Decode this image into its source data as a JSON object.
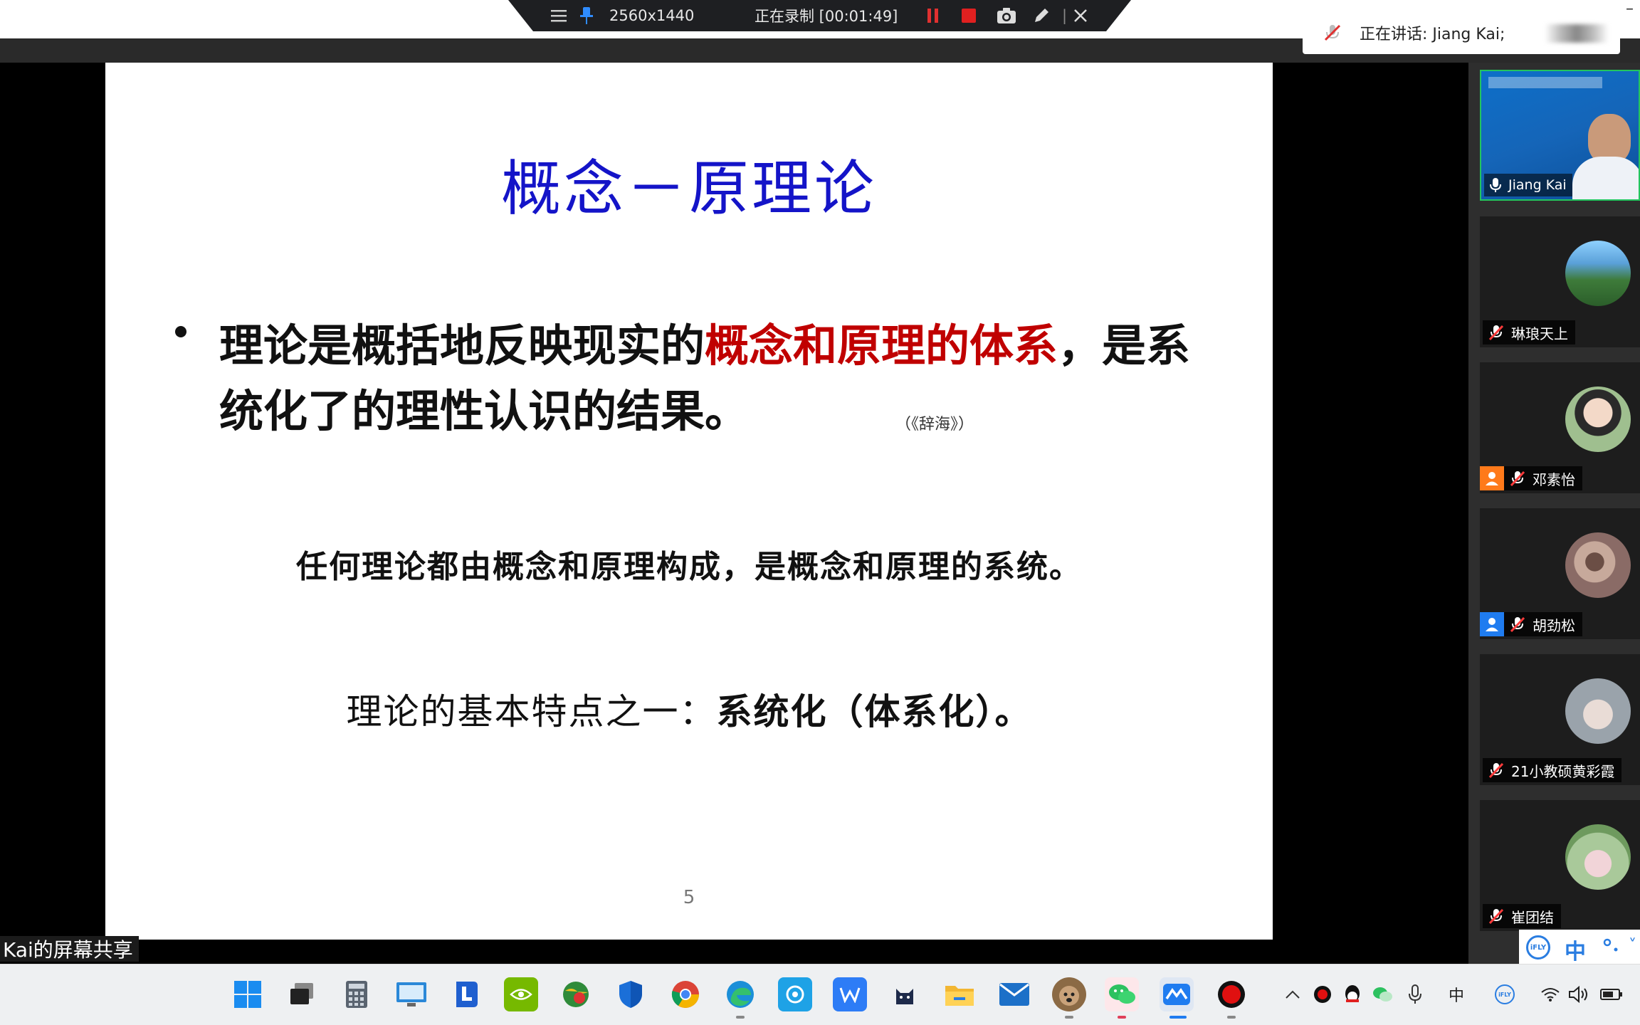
{
  "recording_toolbar": {
    "resolution": "2560x1440",
    "status": "正在录制 [00:01:49]"
  },
  "active_speaker": {
    "text": "正在讲话: Jiang Kai;"
  },
  "slide": {
    "title": "概念－原理论",
    "bullet_part1": "理论是概括地反映现实的",
    "bullet_highlight": "概念和原理的体系",
    "bullet_part2": "，是系统化了的理性认识的结果。",
    "citation": "（《辞海》）",
    "line2": "任何理论都由概念和原理构成，是概念和原理的系统。",
    "line3_part1": "理论的基本特点之一：",
    "line3_part2": "系统化（体系化）。",
    "page_number": "5",
    "colors": {
      "title": "#1414c8",
      "highlight": "#c00000"
    }
  },
  "share_label": "Kai的屏幕共享",
  "participants": [
    {
      "name": "Jiang Kai",
      "mic": "on",
      "video": true
    },
    {
      "name": "琳琅天上",
      "mic": "muted"
    },
    {
      "name": "邓素怡",
      "mic": "muted",
      "badge": "orange-user"
    },
    {
      "name": "胡劲松",
      "mic": "muted",
      "badge": "blue-user"
    },
    {
      "name": "21小教硕黄彩霞",
      "mic": "muted"
    },
    {
      "name": "崔团结",
      "mic": "muted"
    }
  ],
  "ime": {
    "mode": "中",
    "brand": "iFLY"
  },
  "taskbar": {
    "apps": [
      "start-icon",
      "task-view-icon",
      "calculator-icon",
      "remote-desktop-icon",
      "lenovo-icon",
      "nvidia-icon",
      "globe-icon",
      "defender-icon",
      "chrome-icon",
      "edge-icon",
      "camera-app-icon",
      "wps-icon",
      "cat-app-icon",
      "file-explorer-icon",
      "mail-icon",
      "dog-avatar-icon",
      "wechat-icon",
      "tencent-meeting-icon",
      "record-icon"
    ],
    "tray": {
      "input_lang": "中",
      "ime_brand": "iFLY"
    }
  }
}
